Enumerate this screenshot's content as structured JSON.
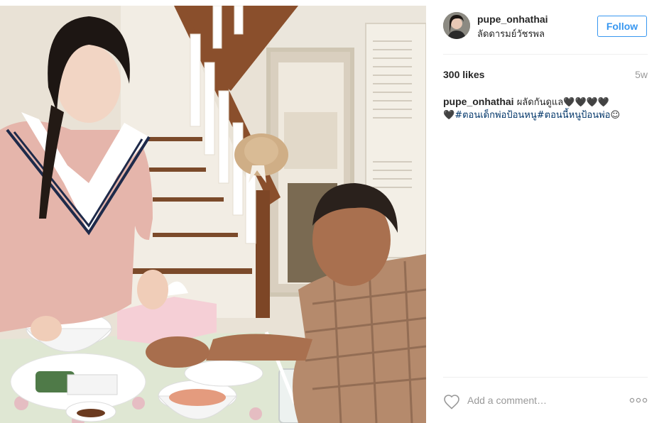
{
  "post": {
    "photo_alt": "",
    "author": {
      "username": "pupe_onhathai",
      "location": "ลัดดารมย์วัชรพล",
      "avatar": "profile-avatar"
    },
    "follow_label": "Follow",
    "likes": "300 likes",
    "time_ago": "5w",
    "caption": {
      "username": "pupe_onhathai",
      "text": " ผลัดกันดูแล🖤🖤🖤🖤",
      "line2_prefix": "🖤",
      "hashtags": [
        "#ตอนเด็กพ่อป้อนหนู",
        "#ตอนนี้หนูป้อนพ่อ"
      ],
      "suffix": "☺"
    },
    "comment_placeholder": "Add a comment…",
    "icons": {
      "like": "heart-outline-icon",
      "more": "more-options-icon"
    },
    "colors": {
      "accent": "#3897f0",
      "hashtag": "#003569",
      "muted": "#999999",
      "text": "#262626",
      "divider": "#efefef"
    }
  }
}
